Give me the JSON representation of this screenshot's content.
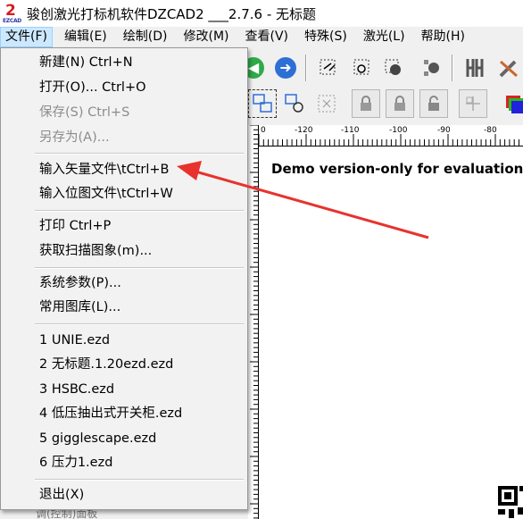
{
  "window": {
    "title": "骏创激光打标机软件DZCAD2 ___2.7.6 - 无标题",
    "icon_glyph": "2",
    "icon_caption": "EZCAD"
  },
  "menubar": {
    "items": [
      {
        "label": "文件(F)",
        "active": true
      },
      {
        "label": "编辑(E)"
      },
      {
        "label": "绘制(D)"
      },
      {
        "label": "修改(M)"
      },
      {
        "label": "查看(V)"
      },
      {
        "label": "特殊(S)"
      },
      {
        "label": "激光(L)"
      },
      {
        "label": "帮助(H)"
      }
    ]
  },
  "file_menu": {
    "new": "新建(N) Ctrl+N",
    "open": "打开(O)... Ctrl+O",
    "save": "保存(S) Ctrl+S",
    "save_as": "另存为(A)...",
    "import_vector": "输入矢量文件\\tCtrl+B",
    "import_bitmap": "输入位图文件\\tCtrl+W",
    "print": "打印 Ctrl+P",
    "scan": "获取扫描图象(m)...",
    "system_params": "系统参数(P)...",
    "library": "常用图库(L)...",
    "recent": [
      "1 UNIE.ezd",
      "2 无标题.1.20ezd.ezd",
      "3 HSBC.ezd",
      "4 低压抽出式开关柜.ezd",
      "5 gigglescape.ezd",
      "6 压力1.ezd"
    ],
    "exit": "退出(X)"
  },
  "canvas": {
    "watermark": "Demo version-only for evaluation",
    "ruler_labels": [
      "0",
      "-120",
      "-110",
      "-100",
      "-90",
      "-80"
    ]
  },
  "colors": {
    "arrow": "#e8322e",
    "nav_buttons": "#2e6fd6",
    "back_button": "#2faa4a",
    "menu_active_bg": "#cce8ff"
  },
  "icons": {
    "toolbar1": [
      "back-icon",
      "forward-icon",
      "select-node-icon",
      "select-group-icon",
      "select-fill-icon",
      "select-point-icon",
      "hatch-icon",
      "tool-icon"
    ],
    "toolbar2": [
      "group-select-icon",
      "rotate-select-icon",
      "grid-icon",
      "lock-icon",
      "unlock-icon",
      "lock-all-icon",
      "align-icon",
      "color-icon"
    ]
  },
  "bottom_partial_text": "调(控制)面板"
}
